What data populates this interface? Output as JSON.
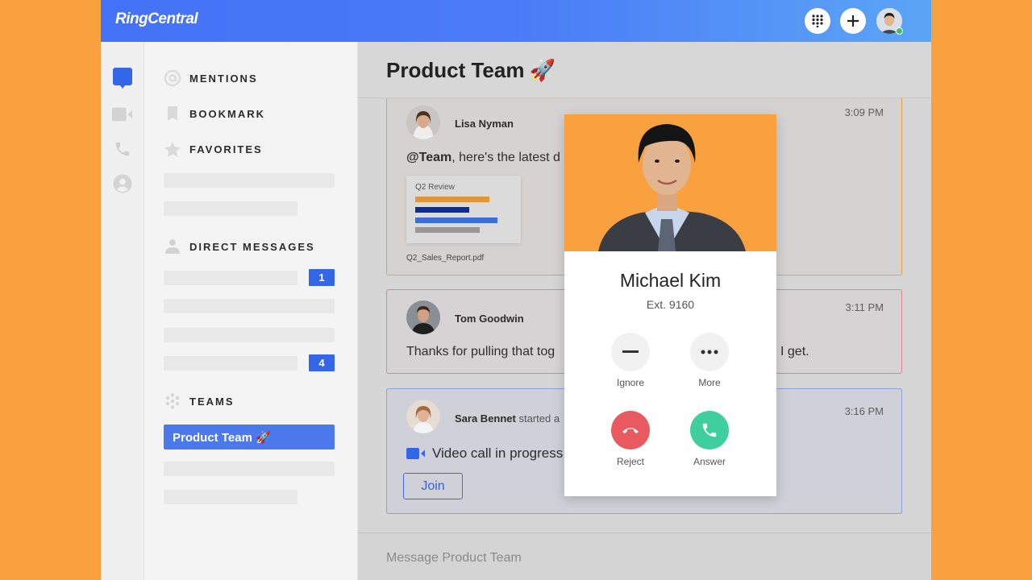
{
  "app": {
    "brand": "RingCentral",
    "accent": "#4472f6"
  },
  "topbar": {
    "dialpad_icon": "dialpad-icon",
    "add_icon": "plus-icon",
    "user_avatar": "user-avatar",
    "presence": "online"
  },
  "rail": {
    "items": [
      {
        "icon": "message-icon",
        "active": true
      },
      {
        "icon": "video-icon",
        "active": false
      },
      {
        "icon": "phone-icon",
        "active": false
      },
      {
        "icon": "contacts-icon",
        "active": false
      }
    ]
  },
  "nav": {
    "mentions": "MENTIONS",
    "bookmark": "BOOKMARK",
    "favorites": "FAVORITES",
    "direct_messages": "DIRECT MESSAGES",
    "dm_badges": [
      "1",
      "4"
    ],
    "teams": "TEAMS",
    "active_team": "Product Team 🚀"
  },
  "main": {
    "title": "Product Team",
    "title_emoji": "🚀",
    "messages": [
      {
        "sender": "Lisa Nyman",
        "time": "3:09 PM",
        "mention": "@Team",
        "text": ", here's the latest d",
        "attachment": {
          "title": "Q2 Review",
          "filename": "Q2_Sales_Report.pdf",
          "bars": [
            {
              "value": 0.77,
              "color": "#e3953a"
            },
            {
              "value": 0.56,
              "color": "#0b2d96"
            },
            {
              "value": 0.85,
              "color": "#3d6ed8"
            },
            {
              "value": 0.67,
              "color": "#9a9796"
            }
          ]
        }
      },
      {
        "sender": "Tom Goodwin",
        "time": "3:11 PM",
        "text_left": "Thanks for pulling that tog",
        "text_right": "I get."
      },
      {
        "sender": "Sara Bennet",
        "action": " started a",
        "time": "3:16 PM",
        "video_text": "Video call in progress",
        "join_label": "Join"
      }
    ],
    "composer_placeholder": "Message Product Team"
  },
  "incoming_call": {
    "name": "Michael Kim",
    "ext": "Ext. 9160",
    "ignore_label": "Ignore",
    "more_label": "More",
    "reject_label": "Reject",
    "answer_label": "Answer",
    "reject_color": "#e85a5f",
    "answer_color": "#3fcf9f"
  }
}
